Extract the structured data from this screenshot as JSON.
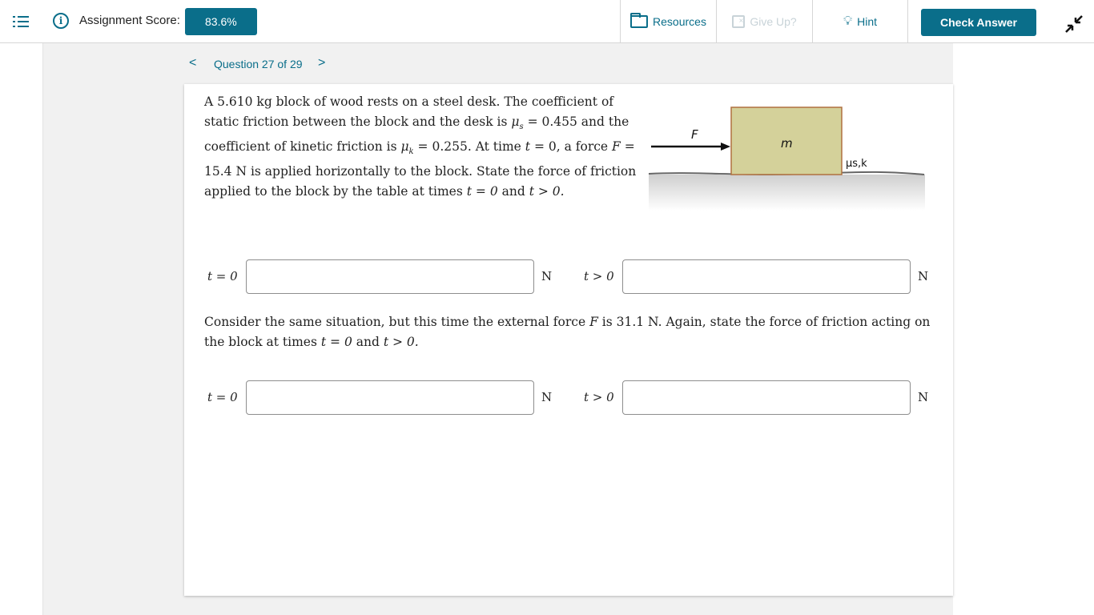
{
  "header": {
    "score_label": "Assignment Score:",
    "score_value": "83.6%",
    "resources_label": "Resources",
    "giveup_label": "Give Up?",
    "hint_label": "Hint",
    "check_label": "Check Answer"
  },
  "navigation": {
    "question_label": "Question 27 of 29",
    "prev_icon": "chevron-left-icon",
    "next_icon": "chevron-right-icon"
  },
  "problem": {
    "part1_intro": "A 5.610 kg block of wood rests on a steel desk. The coefficient of static friction between the block and the desk is",
    "mu_s_symbol": "μ",
    "mu_s_sub": "s",
    "mu_s_value": "= 0.455",
    "mid_text": "and the coefficient of kinetic friction is",
    "mu_k_symbol": "μ",
    "mu_k_sub": "k",
    "mu_k_value": "= 0.255.",
    "time_text": "At time",
    "t_var": "t",
    "t_eq": "= 0,",
    "force_text": "a force",
    "F_var": "F",
    "force_value": "= 15.4 N",
    "rest_text": "is applied horizontally to the block. State the force of friction applied to the block by the table at times",
    "t0": "t = 0",
    "and": "and",
    "tgt0": "t > 0."
  },
  "diagram": {
    "force_label": "F",
    "mass_label": "m",
    "mu_label": "μs,k",
    "block_color": "#d4d19a",
    "block_border": "#b07040"
  },
  "answers_part1": [
    {
      "label": "t = 0",
      "unit": "N",
      "value": ""
    },
    {
      "label": "t > 0",
      "unit": "N",
      "value": ""
    }
  ],
  "problem2": {
    "text_a": "Consider the same situation, but this time the external force",
    "F_var": "F",
    "text_b": "is 31.1 N. Again, state the force of friction acting on the block at times",
    "t0": "t = 0",
    "and": "and",
    "tgt0": "t > 0."
  },
  "answers_part2": [
    {
      "label": "t = 0",
      "unit": "N",
      "value": ""
    },
    {
      "label": "t > 0",
      "unit": "N",
      "value": ""
    }
  ],
  "colors": {
    "accent": "#0a6e8a",
    "disabled": "#c8d3d8"
  }
}
